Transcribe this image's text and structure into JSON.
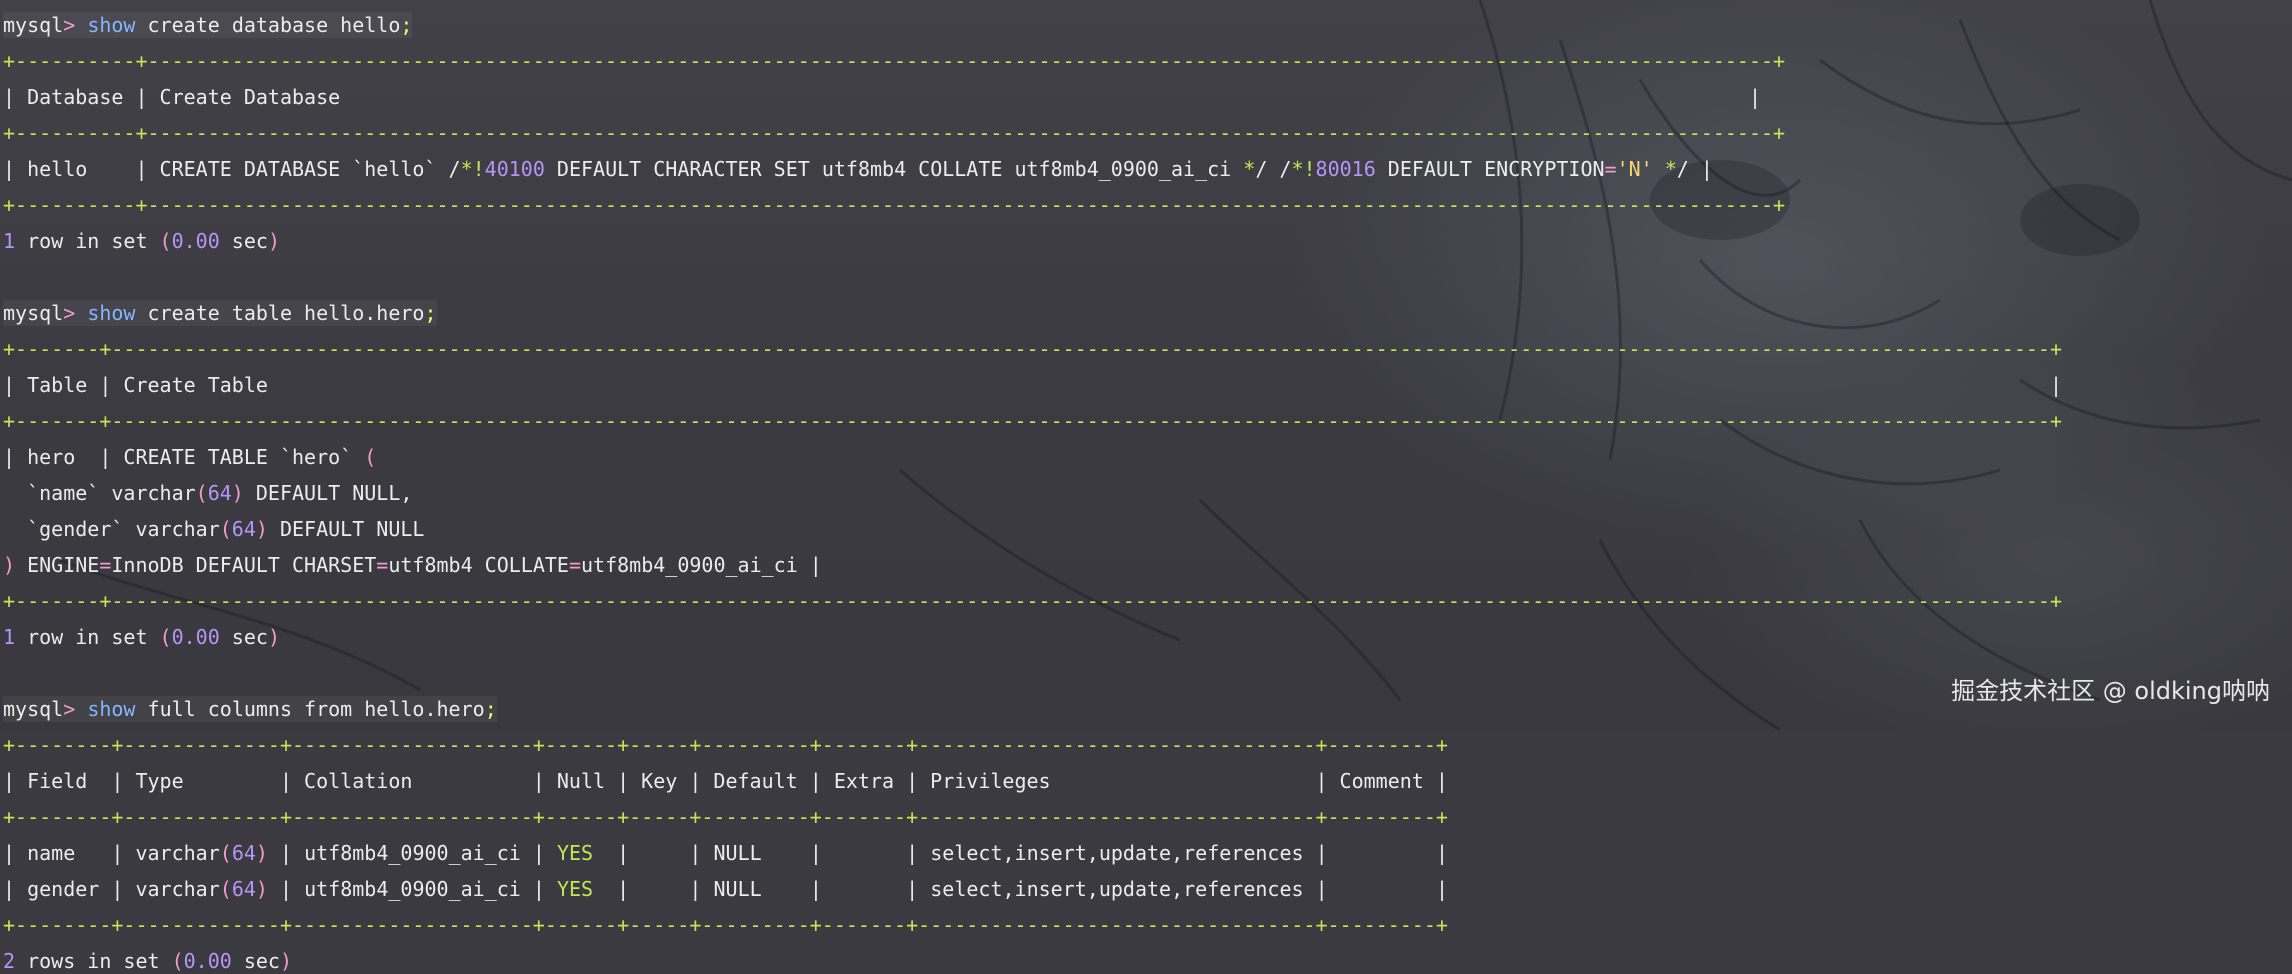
{
  "colors": {
    "prompt_arrow": "#f29bd0",
    "keyword": "#82b6ff",
    "table_border": "#c9e356",
    "number": "#b794f6",
    "string": "#f4d96e",
    "text": "#ececec"
  },
  "q1": {
    "prompt": "mysql",
    "arrow": ">",
    "keyword": "show",
    "rest": " create database hello",
    "semi": ";",
    "border_top": "+----------+---------------------------------------------------------------------------------------------------------------------------------------+",
    "border_row": "+----------+---------------------------------------------------------------------------------------------------------------------------------------+",
    "border_bottom": "+----------+---------------------------------------------------------------------------------------------------------------------------------------+",
    "header": "| Database | Create Database                                                                                                                     |",
    "r_a": "| hello    | CREATE DATABASE `hello` /",
    "r_b": "*!",
    "r_c": "40100",
    "r_d": " DEFAULT CHARACTER SET utf8mb4 COLLATE utf8mb4_0900_ai_ci ",
    "r_e": "*",
    "r_f": "/ /",
    "r_g": "*!",
    "r_h": "80016",
    "r_i": " DEFAULT ENCRYPTION",
    "r_j": "=",
    "r_k": "'N'",
    "r_l": " *",
    "r_m": "/ |",
    "res_a": "1",
    "res_b": " row in set ",
    "res_c": "(",
    "res_d": "0.00",
    "res_e": " sec",
    "res_f": ")"
  },
  "q2": {
    "prompt": "mysql",
    "arrow": ">",
    "keyword": "show",
    "rest": " create table hello.hero",
    "semi": ";",
    "border_top": "+-------+-----------------------------------------------------------------------------------------------------------------------------------------------------------------+",
    "border_row": "+-------+-----------------------------------------------------------------------------------------------------------------------------------------------------------------+",
    "border_bottom": "+-------+-----------------------------------------------------------------------------------------------------------------------------------------------------------------+",
    "header": "| Table | Create Table                                                                                                                                                    |",
    "r1_a": "| hero  | CREATE TABLE `hero` ",
    "r1_b": "(",
    "r2_a": "  `name` varchar",
    "r2_b": "(",
    "r2_c": "64",
    "r2_d": ")",
    "r2_e": " DEFAULT NULL,",
    "r3_a": "  `gender` varchar",
    "r3_b": "(",
    "r3_c": "64",
    "r3_d": ")",
    "r3_e": " DEFAULT NULL",
    "r4_a": ")",
    "r4_b": " ENGINE",
    "r4_c": "=",
    "r4_d": "InnoDB DEFAULT CHARSET",
    "r4_e": "=",
    "r4_f": "utf8mb4 COLLATE",
    "r4_g": "=",
    "r4_h": "utf8mb4_0900_ai_ci |",
    "res_a": "1",
    "res_b": " row in set ",
    "res_c": "(",
    "res_d": "0.00",
    "res_e": " sec",
    "res_f": ")"
  },
  "q3": {
    "prompt": "mysql",
    "arrow": ">",
    "keyword": "show",
    "rest": " full columns from hello.hero",
    "semi": ";",
    "border": "+--------+-------------+--------------------+------+-----+---------+-------+---------------------------------+---------+",
    "header": "| Field  | Type        | Collation          | Null | Key | Default | Extra | Privileges                      | Comment |",
    "rows": [
      {
        "field": "name  ",
        "type_a": "varchar",
        "type_n": "64",
        "collation": "utf8mb4_0900_ai_ci",
        "null": "YES",
        "default": "NULL",
        "privileges": "select,insert,update,references"
      },
      {
        "field": "gender",
        "type_a": "varchar",
        "type_n": "64",
        "collation": "utf8mb4_0900_ai_ci",
        "null": "YES",
        "default": "NULL",
        "privileges": "select,insert,update,references"
      }
    ],
    "res_a": "2",
    "res_b": " rows in set ",
    "res_c": "(",
    "res_d": "0.00",
    "res_e": " sec",
    "res_f": ")"
  },
  "watermark": "掘金技术社区 @ oldking呐呐"
}
